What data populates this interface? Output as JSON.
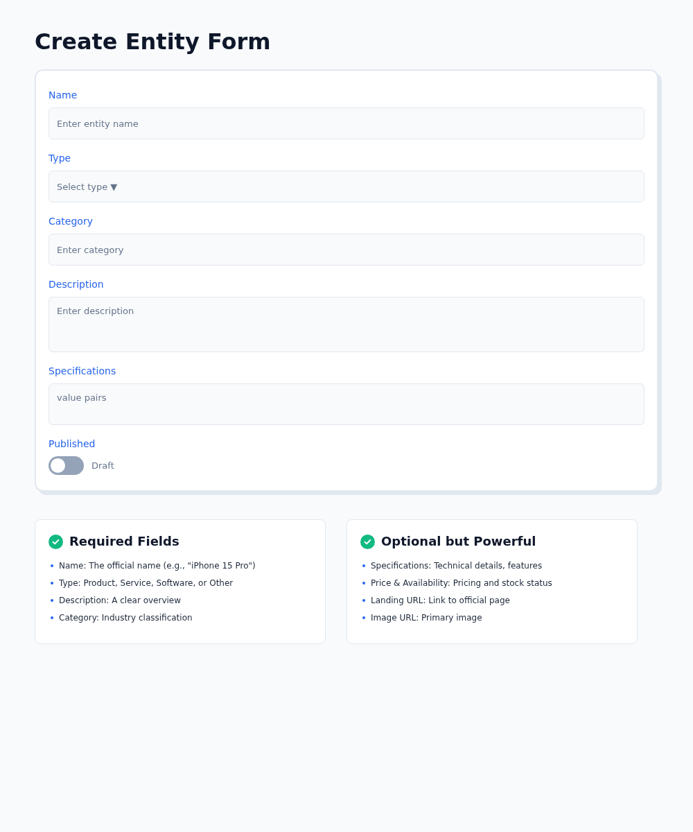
{
  "title": "Create Entity Form",
  "form": {
    "fields": [
      {
        "kind": "text",
        "label": "Name",
        "placeholder": "Enter entity name"
      },
      {
        "kind": "select",
        "label": "Type",
        "placeholder": "Select type",
        "caret": "▼"
      },
      {
        "kind": "text",
        "label": "Category",
        "placeholder": "Enter category"
      },
      {
        "kind": "textarea",
        "label": "Description",
        "placeholder": "Enter description"
      },
      {
        "kind": "pairs",
        "label": "Specifications",
        "placeholder": "value pairs"
      }
    ],
    "toggle": {
      "label": "Published",
      "on": false,
      "state_label": "Draft"
    }
  },
  "info_cards": [
    {
      "title": "Required Fields",
      "items": [
        "Name: The official name (e.g., \"iPhone 15 Pro\")",
        "Type: Product, Service, Software, or Other",
        "Description: A clear overview",
        "Category: Industry classification"
      ]
    },
    {
      "title": "Optional but Powerful",
      "items": [
        "Specifications: Technical details, features",
        "Price & Availability: Pricing and stock status",
        "Landing URL: Link to official page",
        "Image URL: Primary image"
      ]
    }
  ]
}
